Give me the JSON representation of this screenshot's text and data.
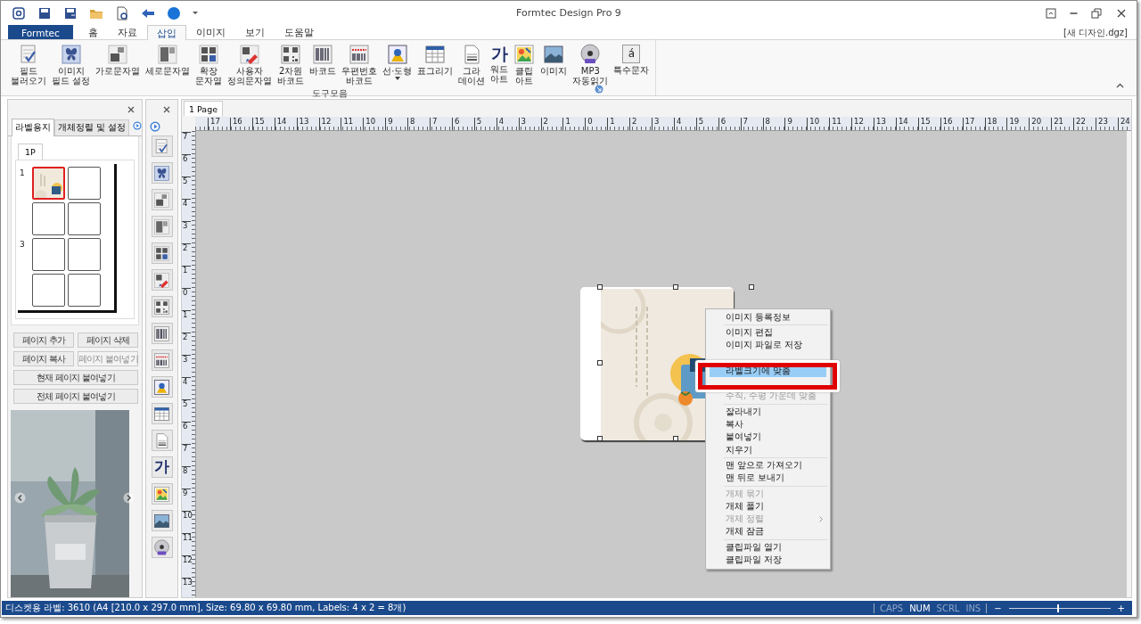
{
  "title_bar": {
    "title": "Formtec Design Pro 9"
  },
  "ribbon": {
    "tabs": [
      {
        "label": "Formtec",
        "kind": "file",
        "selected": false
      },
      {
        "label": "홈",
        "kind": "tab",
        "selected": false
      },
      {
        "label": "자료",
        "kind": "tab",
        "selected": false
      },
      {
        "label": "삽입",
        "kind": "tab",
        "selected": true
      },
      {
        "label": "이미지",
        "kind": "tab",
        "selected": false
      },
      {
        "label": "보기",
        "kind": "tab",
        "selected": false
      },
      {
        "label": "도움말",
        "kind": "tab",
        "selected": false
      }
    ],
    "document": "[새 디자인.dgz]",
    "buttons": [
      {
        "label": "필드\n불러오기",
        "dropdown": false
      },
      {
        "label": "이미지\n필드 설정",
        "dropdown": false
      },
      {
        "label": "가로문자열",
        "dropdown": false
      },
      {
        "label": "세로문자열",
        "dropdown": false
      },
      {
        "label": "확장\n문자열",
        "dropdown": false
      },
      {
        "label": "사용자\n정의문자열",
        "dropdown": false
      },
      {
        "label": "2차원\n바코드",
        "dropdown": false
      },
      {
        "label": "바코드",
        "dropdown": false
      },
      {
        "label": "우편번호\n바코드",
        "dropdown": false
      },
      {
        "label": "선·도형",
        "dropdown": true
      },
      {
        "label": "표그리기",
        "dropdown": false
      },
      {
        "label": "그라\n데이션",
        "dropdown": false
      },
      {
        "label": "워드\n아트",
        "glyph": "가",
        "dropdown": false
      },
      {
        "label": "클립\n아트",
        "dropdown": false
      },
      {
        "label": "이미지",
        "dropdown": false
      },
      {
        "label": "MP3\n자동읽기",
        "dropdown": false
      },
      {
        "label": "특수문자",
        "glyph": "á",
        "dropdown": false
      }
    ],
    "group": "도구모음"
  },
  "label_panel": {
    "tabs": [
      {
        "label": "라벨용지",
        "selected": true
      },
      {
        "label": "개체정렬 및 설정",
        "selected": false
      }
    ],
    "page_tab": "1P",
    "rows": [
      {
        "number": "1",
        "cells": [
          {
            "selected": true
          },
          {
            "selected": false
          }
        ]
      },
      {
        "cells": [
          {
            "selected": false
          },
          {
            "selected": false
          }
        ]
      },
      {
        "number": "3",
        "cells": [
          {
            "selected": false
          },
          {
            "selected": false
          }
        ]
      },
      {
        "cells": [
          {
            "selected": false
          },
          {
            "selected": false
          }
        ]
      }
    ],
    "buttons": [
      {
        "label": "페이지 추가",
        "kind": "half",
        "disabled": false
      },
      {
        "label": "페이지 삭제",
        "kind": "half",
        "disabled": false
      },
      {
        "label": "페이지 복사",
        "kind": "half",
        "disabled": false
      },
      {
        "label": "페이지 붙여넣기",
        "kind": "half",
        "disabled": true
      },
      {
        "label": "현재 페이지 붙여넣기",
        "kind": "full",
        "disabled": false
      },
      {
        "label": "전체 페이지 붙여넣기",
        "kind": "full",
        "disabled": false
      }
    ],
    "ad": {
      "kind": "picture"
    }
  },
  "tool_strip": {
    "wordart_glyph": "가"
  },
  "designer": {
    "tab": "1 Page",
    "top_ruler": [
      "17",
      "16",
      "15",
      "14",
      "13",
      "12",
      "11",
      "10",
      "9",
      "8",
      "7",
      "6",
      "5",
      "4",
      "3",
      "2",
      "1",
      "0",
      "1",
      "2",
      "3",
      "4",
      "5",
      "6",
      "7",
      "8",
      "9",
      "10",
      "11",
      "12",
      "13",
      "14",
      "15",
      "16",
      "17",
      "18",
      "19",
      "20",
      "21",
      "22",
      "23",
      "24"
    ],
    "left_ruler": [
      "7",
      "6",
      "5",
      "4",
      "3",
      "2",
      "1",
      "0",
      "1",
      "2",
      "3",
      "4",
      "5",
      "6",
      "7",
      "8",
      "9",
      "10",
      "11",
      "12",
      "13"
    ],
    "label": {
      "kind": "picture",
      "selected": true
    },
    "context_menu": {
      "items": [
        {
          "kind": "item",
          "label": "이미지 등록정보",
          "disabled": false,
          "selected": false,
          "submenu": false
        },
        {
          "kind": "separator"
        },
        {
          "kind": "item",
          "label": "이미지 편집",
          "disabled": false,
          "selected": false,
          "submenu": false
        },
        {
          "kind": "item",
          "label": "이미지 파일로 저장",
          "disabled": false,
          "selected": false,
          "submenu": false
        },
        {
          "kind": "gap"
        },
        {
          "kind": "item",
          "label": "라벨크기에 맞춤",
          "disabled": false,
          "selected": true,
          "submenu": false
        },
        {
          "kind": "gap"
        },
        {
          "kind": "item",
          "label": "수직, 수평 가운데 맞춤",
          "disabled": true,
          "selected": false,
          "submenu": false
        },
        {
          "kind": "separator"
        },
        {
          "kind": "item",
          "label": "잘라내기",
          "disabled": false,
          "selected": false,
          "submenu": false
        },
        {
          "kind": "item",
          "label": "복사",
          "disabled": false,
          "selected": false,
          "submenu": false
        },
        {
          "kind": "item",
          "label": "붙여넣기",
          "disabled": false,
          "selected": false,
          "submenu": false
        },
        {
          "kind": "item",
          "label": "지우기",
          "disabled": false,
          "selected": false,
          "submenu": false
        },
        {
          "kind": "separator"
        },
        {
          "kind": "item",
          "label": "맨 앞으로 가져오기",
          "disabled": false,
          "selected": false,
          "submenu": false
        },
        {
          "kind": "item",
          "label": "맨 뒤로 보내기",
          "disabled": false,
          "selected": false,
          "submenu": false
        },
        {
          "kind": "separator"
        },
        {
          "kind": "item",
          "label": "개체 묶기",
          "disabled": true,
          "selected": false,
          "submenu": false
        },
        {
          "kind": "item",
          "label": "개체 풀기",
          "disabled": false,
          "selected": false,
          "submenu": false
        },
        {
          "kind": "item",
          "label": "개체 정렬",
          "disabled": true,
          "selected": false,
          "submenu": true
        },
        {
          "kind": "item",
          "label": "개체 잠금",
          "disabled": false,
          "selected": false,
          "submenu": false
        },
        {
          "kind": "separator"
        },
        {
          "kind": "item",
          "label": "클립파일 열기",
          "disabled": false,
          "selected": false,
          "submenu": false
        },
        {
          "kind": "item",
          "label": "클립파일 저장",
          "disabled": false,
          "selected": false,
          "submenu": false
        }
      ]
    }
  },
  "status_bar": {
    "text": "디스켓용 라벨: 3610 (A4 [210.0 x 297.0 mm], Size: 69.80 x 69.80 mm,  Labels: 4 x 2 = 8개)",
    "indicators": [
      {
        "label": "CAPS",
        "on": false
      },
      {
        "label": "NUM",
        "on": true
      },
      {
        "label": "SCRL",
        "on": false
      },
      {
        "label": "INS",
        "on": false
      }
    ],
    "zoom": {
      "minus": "−",
      "plus": "+",
      "level": 0.49
    }
  }
}
